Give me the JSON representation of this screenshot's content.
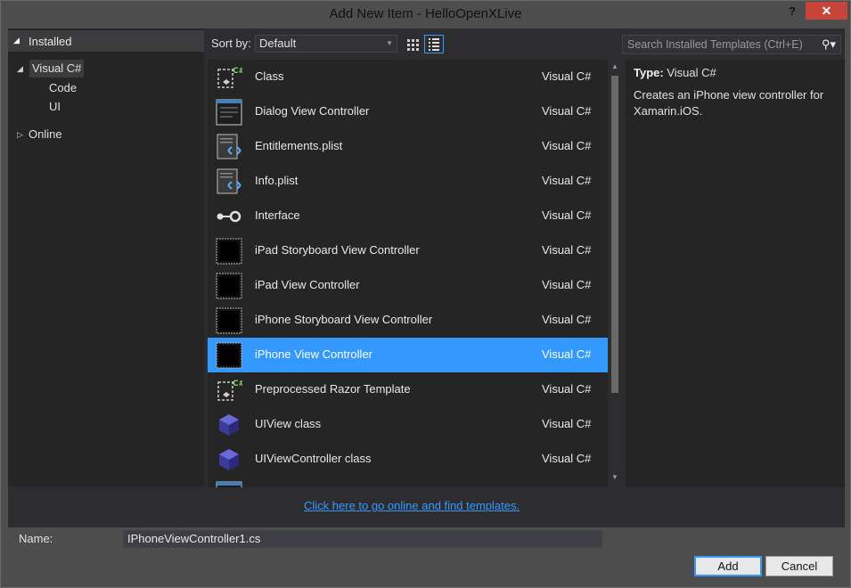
{
  "window": {
    "title": "Add New Item - HelloOpenXLive",
    "help_label": "?",
    "close_label": "✕"
  },
  "tree": {
    "header": "Installed",
    "nodes": [
      {
        "label": "Visual C#",
        "selected": true
      },
      {
        "label": "Code"
      },
      {
        "label": "UI"
      },
      {
        "label": "Online"
      }
    ]
  },
  "toolbar": {
    "sort_label": "Sort by:",
    "sort_value": "Default",
    "search_placeholder": "Search Installed Templates (Ctrl+E)"
  },
  "templates": [
    {
      "name": "Class",
      "lang": "Visual C#",
      "icon": "class-icon"
    },
    {
      "name": "Dialog View Controller",
      "lang": "Visual C#",
      "icon": "dialog-icon"
    },
    {
      "name": "Entitlements.plist",
      "lang": "Visual C#",
      "icon": "plist-icon"
    },
    {
      "name": "Info.plist",
      "lang": "Visual C#",
      "icon": "plist-icon"
    },
    {
      "name": "Interface",
      "lang": "Visual C#",
      "icon": "interface-icon"
    },
    {
      "name": "iPad Storyboard View Controller",
      "lang": "Visual C#",
      "icon": "viewcontroller-icon"
    },
    {
      "name": "iPad View Controller",
      "lang": "Visual C#",
      "icon": "viewcontroller-icon"
    },
    {
      "name": "iPhone Storyboard View Controller",
      "lang": "Visual C#",
      "icon": "viewcontroller-icon"
    },
    {
      "name": "iPhone View Controller",
      "lang": "Visual C#",
      "icon": "viewcontroller-icon",
      "selected": true
    },
    {
      "name": "Preprocessed Razor Template",
      "lang": "Visual C#",
      "icon": "class-icon"
    },
    {
      "name": "UIView class",
      "lang": "Visual C#",
      "icon": "cube-icon"
    },
    {
      "name": "UIViewController class",
      "lang": "Visual C#",
      "icon": "cube-icon"
    }
  ],
  "details": {
    "type_label": "Type:",
    "type_value": "Visual C#",
    "description": "Creates an iPhone view controller for Xamarin.iOS."
  },
  "online_link": "Click here to go online and find templates.",
  "footer": {
    "name_label": "Name:",
    "name_value": "IPhoneViewController1.cs",
    "add_label": "Add",
    "cancel_label": "Cancel"
  },
  "colors": {
    "accent": "#3399ff",
    "close": "#c7443a"
  }
}
